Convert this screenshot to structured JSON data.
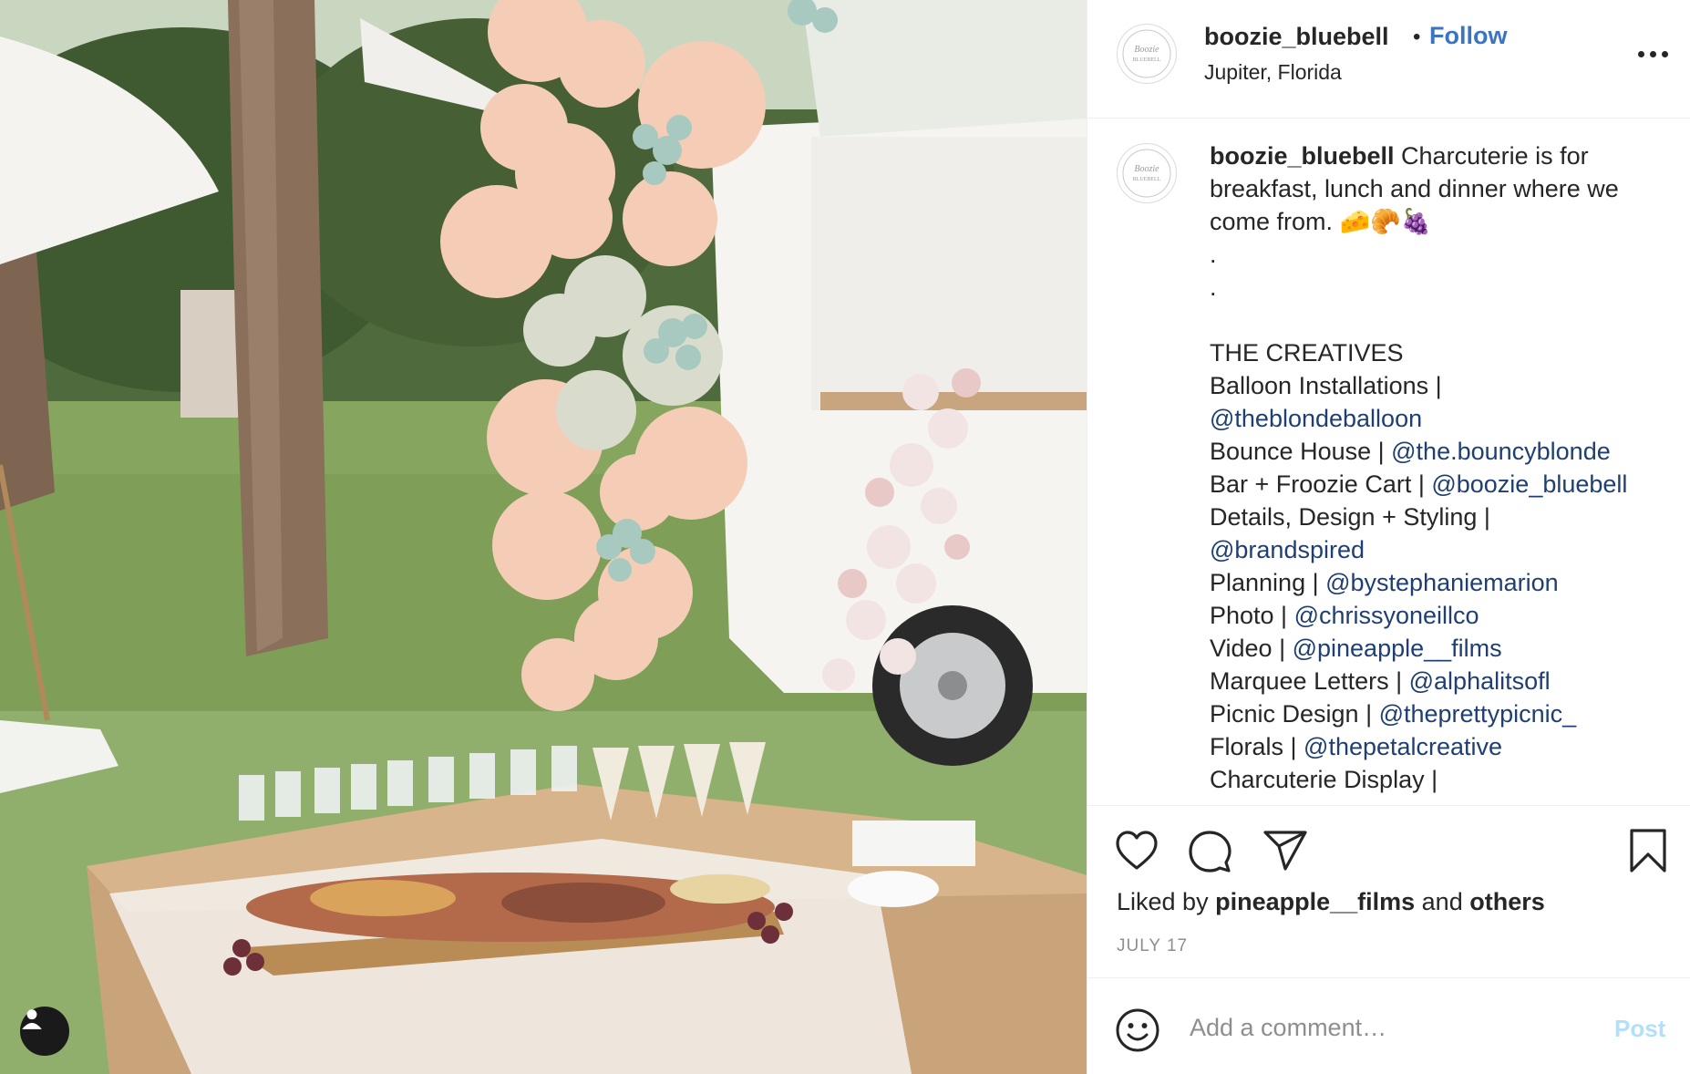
{
  "post": {
    "username": "boozie_bluebell",
    "dot": "•",
    "follow_label": "Follow",
    "location": "Jupiter, Florida",
    "avatar_text": "Boozie BLUEBELL"
  },
  "caption": {
    "username": "boozie_bluebell",
    "line1": "Charcuterie is for",
    "line2": "breakfast, lunch and dinner where we",
    "line3": "come from. 🧀🥐🍇",
    "dot1": ".",
    "dot2": ".",
    "heading": "THE CREATIVES",
    "credits": [
      {
        "label": "Balloon Installations |",
        "handle": "",
        "wrap": true
      },
      {
        "label": "",
        "handle": "@theblondeballoon"
      },
      {
        "label": "Bounce House | ",
        "handle": "@the.bouncyblonde"
      },
      {
        "label": "Bar + Froozie Cart | ",
        "handle": "@boozie_bluebell"
      },
      {
        "label": "Details, Design + Styling |",
        "handle": ""
      },
      {
        "label": "",
        "handle": "@brandspired"
      },
      {
        "label": "Planning | ",
        "handle": "@bystephaniemarion"
      },
      {
        "label": "Photo | ",
        "handle": "@chrissyoneillco"
      },
      {
        "label": "Video | ",
        "handle": "@pineapple__films"
      },
      {
        "label": "Marquee Letters | ",
        "handle": "@alphalitsofl"
      },
      {
        "label": "Picnic Design | ",
        "handle": "@theprettypicnic_"
      },
      {
        "label": "Florals | ",
        "handle": "@thepetalcreative"
      },
      {
        "label": "Charcuterie Display |",
        "handle": ""
      }
    ]
  },
  "actions": {
    "like_icon": "heart-icon",
    "comment_icon": "comment-icon",
    "share_icon": "paper-plane-icon",
    "save_icon": "bookmark-icon"
  },
  "likes": {
    "prefix": "Liked by ",
    "user": "pineapple__films",
    "middle": " and ",
    "others": "others"
  },
  "date": "JULY 17",
  "comment_box": {
    "placeholder": "Add a comment…",
    "post_label": "Post",
    "emoji_icon": "smiley-icon"
  },
  "colors": {
    "link": "#1f3f73",
    "follow": "#3a75c4",
    "post_disabled": "#b2dffc",
    "meta": "#8e8e8e"
  }
}
